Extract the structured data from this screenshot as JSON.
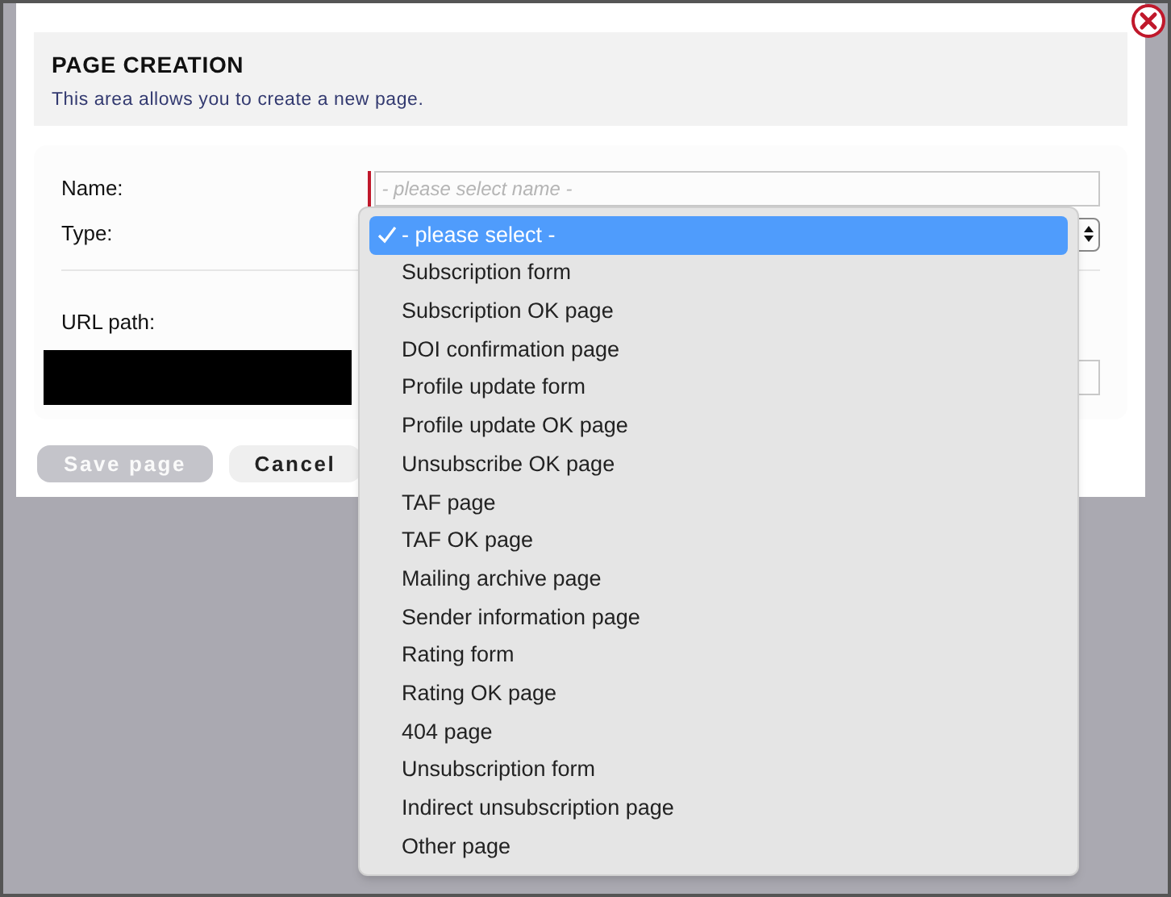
{
  "dialog": {
    "title": "PAGE CREATION",
    "subtitle": "This area allows you to create a new page."
  },
  "form": {
    "name_label": "Name:",
    "name_placeholder": "- please select name -",
    "type_label": "Type:",
    "url_label": "URL path:"
  },
  "buttons": [
    {
      "label": "Save page",
      "disabled": true
    },
    {
      "label": "Cancel",
      "disabled": false
    }
  ],
  "dropdown": {
    "options": [
      {
        "label": "- please select -",
        "selected": true
      },
      {
        "label": "Subscription form",
        "selected": false
      },
      {
        "label": "Subscription OK page",
        "selected": false
      },
      {
        "label": "DOI confirmation page",
        "selected": false
      },
      {
        "label": "Profile update form",
        "selected": false
      },
      {
        "label": "Profile update OK page",
        "selected": false
      },
      {
        "label": "Unsubscribe OK page",
        "selected": false
      },
      {
        "label": "TAF page",
        "selected": false
      },
      {
        "label": "TAF OK page",
        "selected": false
      },
      {
        "label": "Mailing archive page",
        "selected": false
      },
      {
        "label": "Sender information page",
        "selected": false
      },
      {
        "label": "Rating form",
        "selected": false
      },
      {
        "label": "Rating OK page",
        "selected": false
      },
      {
        "label": "404 page",
        "selected": false
      },
      {
        "label": "Unsubscription form",
        "selected": false
      },
      {
        "label": "Indirect unsubscription page",
        "selected": false
      },
      {
        "label": "Other page",
        "selected": false
      }
    ]
  }
}
